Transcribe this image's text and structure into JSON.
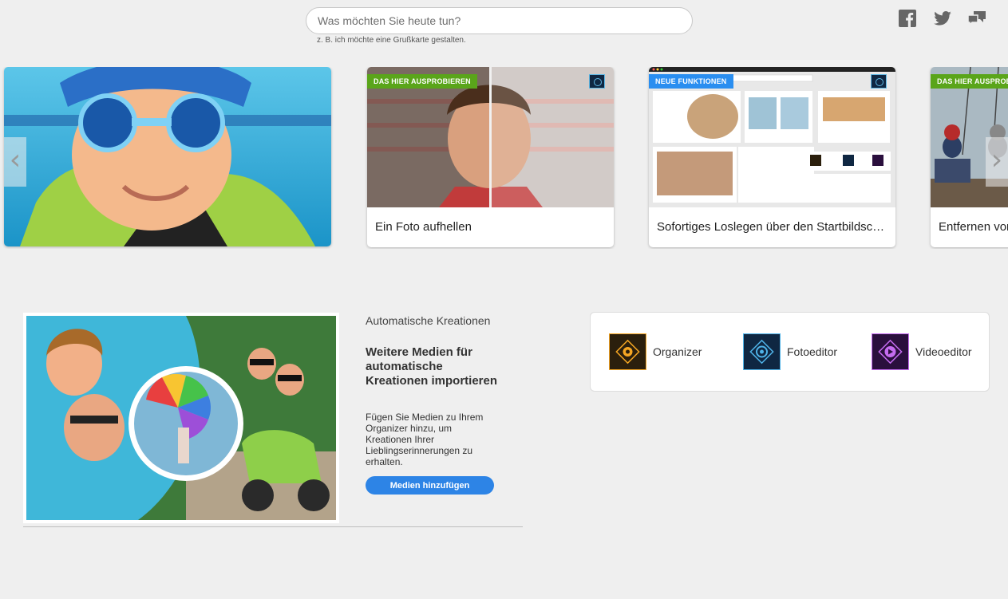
{
  "search": {
    "placeholder": "Was möchten Sie heute tun?",
    "hint": "z. B. ich möchte eine Grußkarte gestalten."
  },
  "social": [
    {
      "name": "facebook-icon"
    },
    {
      "name": "twitter-icon"
    },
    {
      "name": "feedback-icon"
    }
  ],
  "carousel": {
    "cards": [
      {
        "badge": "",
        "caption": ""
      },
      {
        "badge": "DAS HIER AUSPROBIEREN",
        "caption": "Ein Foto aufhellen"
      },
      {
        "badge": "NEUE FUNKTIONEN",
        "caption": "Sofortiges Loslegen über den Startbildschirm"
      },
      {
        "badge": "DAS HIER AUSPROBIEREN",
        "caption": "Entfernen von Objekten"
      }
    ],
    "prev_icon": "‹",
    "next_icon": "›"
  },
  "auto_creations": {
    "title": "Automatische Kreationen",
    "heading": "Weitere Medien für automatische Kreationen importieren",
    "text": "Fügen Sie Medien zu Ihrem Organizer hinzu, um Kreationen Ihrer Lieblingserinnerungen zu erhalten.",
    "button": "Medien hinzufügen"
  },
  "apps": [
    {
      "label": "Organizer",
      "color": "#f5a623"
    },
    {
      "label": "Fotoeditor",
      "color": "#4fb3e8"
    },
    {
      "label": "Videoeditor",
      "color": "#c56cf0"
    }
  ],
  "colors": {
    "accent": "#2d84e6",
    "badge_green": "#5aa51a",
    "badge_blue": "#2a8ef0"
  }
}
